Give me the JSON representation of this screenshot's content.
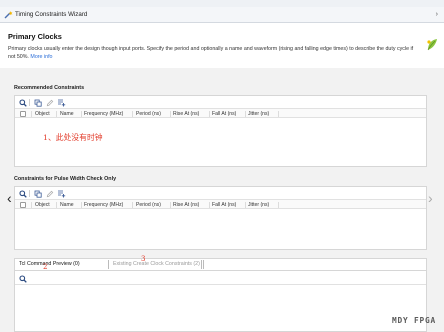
{
  "window": {
    "title": "Timing Constraints Wizard"
  },
  "header": {
    "title": "Primary Clocks",
    "description": "Primary clocks usually enter the design though input ports. Specify the period and optionally a name and waveform (rising and falling edge times) to describe the duty cycle if not 50%.",
    "more_info": "More info"
  },
  "recommended": {
    "title": "Recommended Constraints",
    "columns": [
      "Object",
      "Name",
      "Frequency (MHz)",
      "Period (ns)",
      "Rise At (ns)",
      "Fall At (ns)",
      "Jitter (ns)"
    ],
    "rows": []
  },
  "annotation_note": "1、此处没有时钟",
  "pulse_width": {
    "title": "Constraints for Pulse Width Check Only",
    "columns": [
      "Object",
      "Name",
      "Frequency (MHz)",
      "Period (ns)",
      "Rise At (ns)",
      "Fall At (ns)",
      "Jitter (ns)"
    ],
    "rows": []
  },
  "bottom_tabs": {
    "tcl_preview": "Tcl Command Preview (0)",
    "existing_constraints": "Existing Create Clock Constraints (2)",
    "annotation_2": "2",
    "annotation_3": "3"
  },
  "watermark": "MDY FPGA",
  "icons": [
    "wizard-icon",
    "leaf-icon",
    "search-icon",
    "copy-icon",
    "edit-icon",
    "add-row-icon",
    "arrow-left-icon",
    "arrow-right-icon"
  ],
  "colors": {
    "link": "#2a6dd8",
    "annotation_red": "#e23b2a",
    "leaf_green": "#8bc53f",
    "leaf_yellow": "#f2c200"
  }
}
